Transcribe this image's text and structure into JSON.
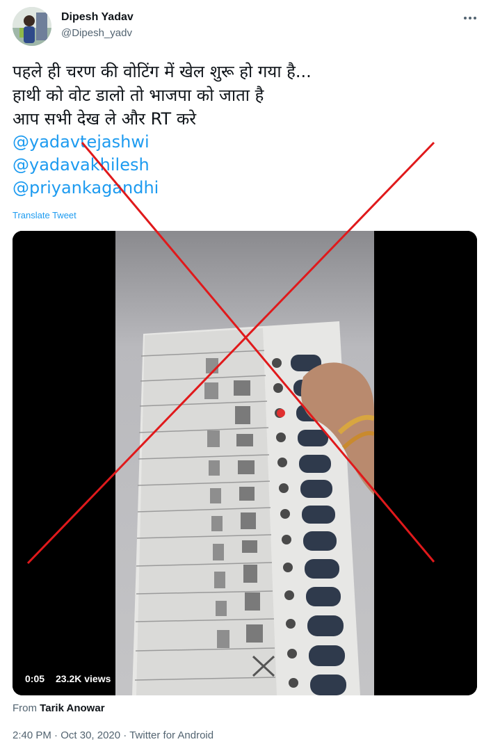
{
  "author": {
    "name": "Dipesh Yadav",
    "handle": "@Dipesh_yadv"
  },
  "more_icon": "ellipsis-icon",
  "tweet": {
    "lines": [
      "पहले ही चरण की वोटिंग में खेल शुरू हो गया है...",
      "हाथी को वोट डालो तो भाजपा को जाता है",
      "आप सभी देख ले और RT करे"
    ],
    "mentions": [
      "@yadavtejashwi",
      "@yadavakhilesh",
      "@priyankagandhi"
    ],
    "translate_label": "Translate Tweet"
  },
  "video": {
    "time": "0:05",
    "views": "23.2K views"
  },
  "from": {
    "label": "From",
    "name": "Tarik Anowar"
  },
  "meta": {
    "time": "2:40 PM",
    "separator": "·",
    "date": "Oct 30, 2020",
    "source": "Twitter for Android"
  },
  "colors": {
    "link": "#1d9bf0",
    "secondary_text": "#536471",
    "overlay_cross": "#e0191b"
  }
}
